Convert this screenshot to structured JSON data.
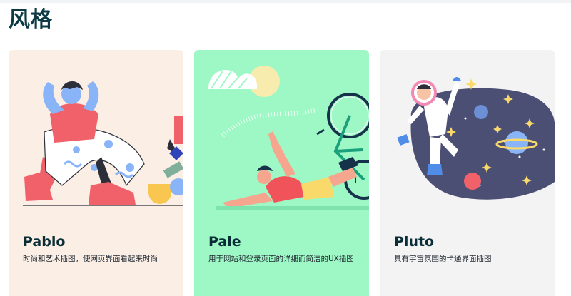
{
  "page": {
    "title": "风格"
  },
  "cards": [
    {
      "name": "Pablo",
      "description": "时尚和艺术插图，使网页界面看起来时尚",
      "background": "#fbeee4"
    },
    {
      "name": "Pale",
      "description": "用于网站和登录页面的详细而简洁的UX插图",
      "background": "#9ef8c5"
    },
    {
      "name": "Pluto",
      "description": "具有宇宙氛围的卡通界面插图",
      "background": "#f4f3f4"
    }
  ],
  "icons": [
    "pablo-illustration",
    "pale-illustration",
    "pluto-illustration"
  ]
}
